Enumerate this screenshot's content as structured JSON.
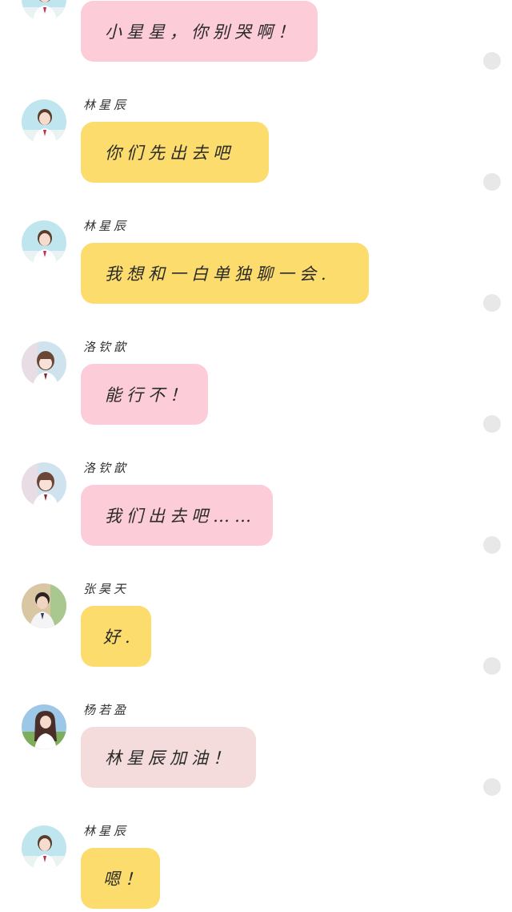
{
  "colors": {
    "pink": "#fcccd8",
    "yellow": "#fcdc6c",
    "light_pink": "#f4dcdc",
    "dot": "#e8e8e8"
  },
  "messages": [
    {
      "sender": "",
      "text": "小星星，你别哭啊！",
      "bubble_color": "pink",
      "avatar": "girl-ponytail-avatar"
    },
    {
      "sender": "林星辰",
      "text": "你们先出去吧",
      "bubble_color": "yellow",
      "avatar": "girl-ponytail-avatar"
    },
    {
      "sender": "林星辰",
      "text": "我想和一白单独聊一会.",
      "bubble_color": "yellow",
      "avatar": "girl-ponytail-avatar"
    },
    {
      "sender": "洛钦歆",
      "text": "能行不！",
      "bubble_color": "pink",
      "avatar": "girl-bangs-avatar"
    },
    {
      "sender": "洛钦歆",
      "text": "我们出去吧……",
      "bubble_color": "pink",
      "avatar": "girl-bangs-avatar"
    },
    {
      "sender": "张昊天",
      "text": "好.",
      "bubble_color": "yellow",
      "avatar": "boy-avatar"
    },
    {
      "sender": "杨若盈",
      "text": "林星辰加油！",
      "bubble_color": "light_pink",
      "avatar": "girl-long-hair-avatar"
    },
    {
      "sender": "林星辰",
      "text": "嗯！",
      "bubble_color": "yellow",
      "avatar": "girl-ponytail-avatar"
    }
  ]
}
